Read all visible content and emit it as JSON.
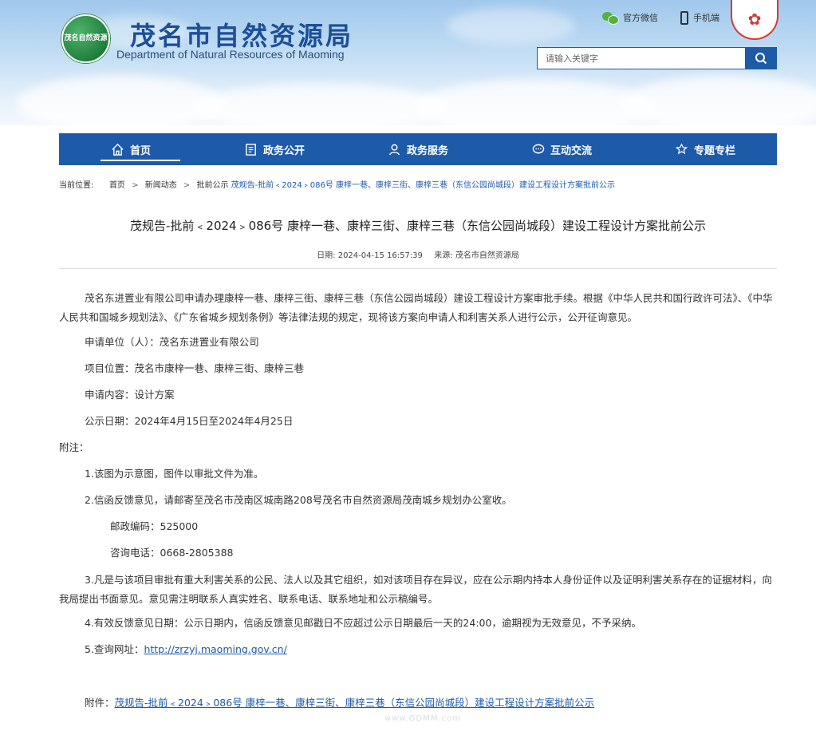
{
  "header": {
    "logo_text": "茂名自然资源",
    "title": "茂名市自然资源局",
    "subtitle": "Department of Natural Resources of Maoming",
    "top_links": [
      {
        "label": "官方微信",
        "icon": "wechat-icon"
      },
      {
        "label": "手机端",
        "icon": "phone-icon"
      }
    ],
    "emblem_icon": "maoming-emblem-icon",
    "search": {
      "placeholder": "请输入关键字",
      "button_icon": "search-icon"
    }
  },
  "nav": {
    "items": [
      {
        "label": "首页",
        "icon": "home-icon",
        "active": true
      },
      {
        "label": "政务公开",
        "icon": "document-icon"
      },
      {
        "label": "政务服务",
        "icon": "service-person-icon"
      },
      {
        "label": "互动交流",
        "icon": "chat-icon"
      },
      {
        "label": "专题专栏",
        "icon": "badge-icon"
      }
    ]
  },
  "breadcrumb": {
    "prefix": "当前位置:",
    "items": [
      "首页",
      "新闻动态",
      "批前公示"
    ],
    "current": "茂规告-批前﹤2024﹥086号 康梓一巷、康梓三街、康梓三巷（东信公园尚城段）建设工程设计方案批前公示"
  },
  "article": {
    "title": "茂规告-批前﹤2024﹥086号 康梓一巷、康梓三街、康梓三巷（东信公园尚城段）建设工程设计方案批前公示",
    "date_label": "日期:",
    "date": "2024-04-15 16:57:39",
    "source_label": "来源:",
    "source": "茂名市自然资源局",
    "intro": "茂名东进置业有限公司申请办理康梓一巷、康梓三街、康梓三巷（东信公园尚城段）建设工程设计方案审批手续。根据《中华人民共和国行政许可法》、《中华人民共和国城乡规划法》、《广东省城乡规划条例》等法律法规的规定，现将该方案向申请人和利害关系人进行公示，公开征询意见。",
    "applicant": "申请单位（人）：茂名东进置业有限公司",
    "location": "项目位置：茂名市康梓一巷、康梓三街、康梓三巷",
    "content": "申请内容：设计方案",
    "period": "公示日期：2024年4月15日至2024年4月25日",
    "notes_title": "附注：",
    "note1": "1.该图为示意图，图件以审批文件为准。",
    "note2": "2.信函反馈意见，请邮寄至茂名市茂南区城南路208号茂名市自然资源局茂南城乡规划办公室收。",
    "postcode": "邮政编码：525000",
    "phone": "咨询电话：0668-2805388",
    "note3": "3.凡是与该项目审批有重大利害关系的公民、法人以及其它组织，如对该项目存在异议，应在公示期内持本人身份证件以及证明利害关系存在的证据材料，向我局提出书面意见。意见需注明联系人真实姓名、联系电话、联系地址和公示稿编号。",
    "note4": "4.有效反馈意见日期：公示日期内，信函反馈意见邮戳日不应超过公示日期最后一天的24:00，逾期视为无效意见，不予采纳。",
    "note5_label": "5.查询网址：",
    "note5_url": "http://zrzyj.maoming.gov.cn/",
    "attachment_label": "附件：",
    "attachment_link": "茂规告-批前﹤2024﹥086号 康梓一巷、康梓三街、康梓三巷（东信公园尚城段）建设工程设计方案批前公示"
  },
  "watermark": "www.GDMM.com",
  "colors": {
    "primary": "#1d5aa8",
    "header_sky": "#c4def4"
  }
}
